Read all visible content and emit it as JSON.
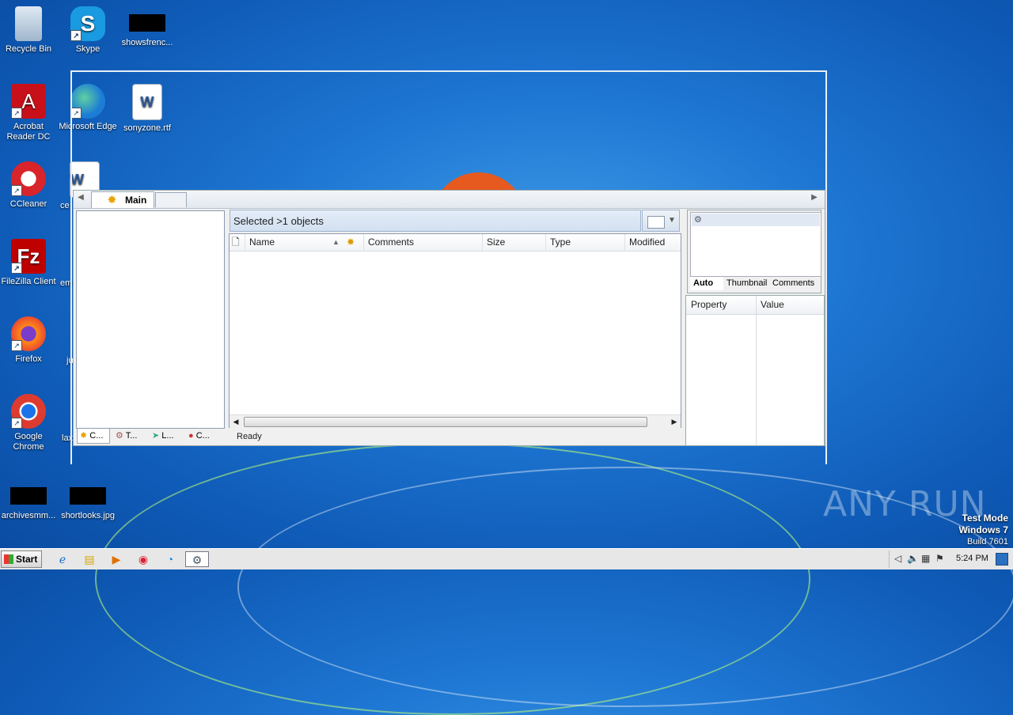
{
  "desktop": {
    "icons": [
      {
        "label": "Recycle Bin",
        "icon": "recycle-bin-icon"
      },
      {
        "label": "Skype",
        "icon": "skype-icon"
      },
      {
        "label": "showsfrenc...",
        "icon": "redacted-file-icon"
      },
      {
        "label": "Acrobat Reader DC",
        "icon": "acrobat-icon"
      },
      {
        "label": "Microsoft Edge",
        "icon": "edge-icon"
      },
      {
        "label": "sonyzone.rtf",
        "icon": "word-doc-icon"
      },
      {
        "label": "CCleaner",
        "icon": "ccleaner-icon"
      },
      {
        "label": "ce",
        "icon": "word-doc-icon"
      },
      {
        "label": "FileZilla Client",
        "icon": "filezilla-icon"
      },
      {
        "label": "em",
        "icon": "redacted-file-icon"
      },
      {
        "label": "Firefox",
        "icon": "firefox-icon"
      },
      {
        "label": "ju",
        "icon": "redacted-file-icon"
      },
      {
        "label": "Google Chrome",
        "icon": "chrome-icon"
      },
      {
        "label": "lax",
        "icon": "redacted-file-icon"
      },
      {
        "label": "archivesmm...",
        "icon": "redacted-file-icon"
      },
      {
        "label": "shortlooks.jpg",
        "icon": "redacted-file-icon"
      }
    ]
  },
  "app": {
    "main_tab": "Main",
    "left_tabs": [
      "C...",
      "T...",
      "L...",
      "C..."
    ],
    "selection_text": "Selected >1 objects",
    "columns": [
      "Name",
      "Comments",
      "Size",
      "Type",
      "Modified"
    ],
    "status": "Ready",
    "thumb_tabs": [
      "Auto",
      "Thumbnail",
      "Comments"
    ],
    "prop_columns": [
      "Property",
      "Value"
    ]
  },
  "watermark": {
    "text": "ANY RUN"
  },
  "os_notice": {
    "line1": "Test Mode",
    "line2": "Windows 7",
    "line3": "Build 7601"
  },
  "taskbar": {
    "start_label": "Start",
    "pinned": [
      "ie-icon",
      "explorer-icon",
      "media-player-icon",
      "chrome-icon",
      "edge-icon",
      "app-icon"
    ],
    "clock": "5:24 PM"
  }
}
